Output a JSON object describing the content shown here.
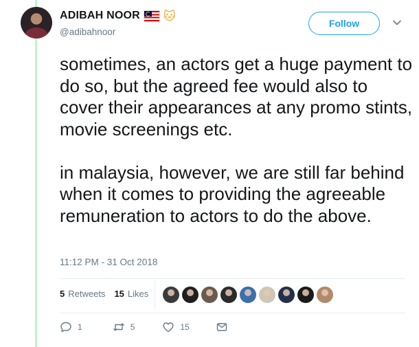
{
  "author": {
    "name": "ADIBAH NOOR",
    "handle": "@adibahnoor",
    "badges": [
      "malaysia-flag-emoji",
      "cat-face-emoji"
    ]
  },
  "follow_label": "Follow",
  "tweet": {
    "paragraphs": [
      "sometimes, an actors get a huge payment to do so, but the agreed fee would also to cover their appearances at any promo stints, movie screenings etc.",
      "in malaysia, however, we are still far behind when it comes to providing the agreeable remuneration to actors to do the above."
    ],
    "timestamp": "11:12 PM - 31 Oct 2018"
  },
  "stats": {
    "retweets_count": "5",
    "retweets_label": "Retweets",
    "likes_count": "15",
    "likes_label": "Likes"
  },
  "likers": [
    {
      "icon": "liker-avatar",
      "color": "#3a3a3a"
    },
    {
      "icon": "liker-avatar",
      "color": "#1f1f1f"
    },
    {
      "icon": "liker-avatar",
      "color": "#6b5a4e"
    },
    {
      "icon": "liker-avatar",
      "color": "#2b2b2b"
    },
    {
      "icon": "liker-avatar",
      "color": "#3b6fb0"
    },
    {
      "icon": "liker-avatar",
      "color": "#cfc6b8"
    },
    {
      "icon": "liker-avatar",
      "color": "#24304a"
    },
    {
      "icon": "liker-avatar",
      "color": "#1a1a1a"
    },
    {
      "icon": "liker-avatar",
      "color": "#b08a6a"
    }
  ],
  "actions": {
    "reply_count": "1",
    "retweet_count": "5",
    "like_count": "15"
  },
  "colors": {
    "accent": "#1da1f2",
    "thread_line": "#c4f0ce",
    "secondary_text": "#657786"
  }
}
